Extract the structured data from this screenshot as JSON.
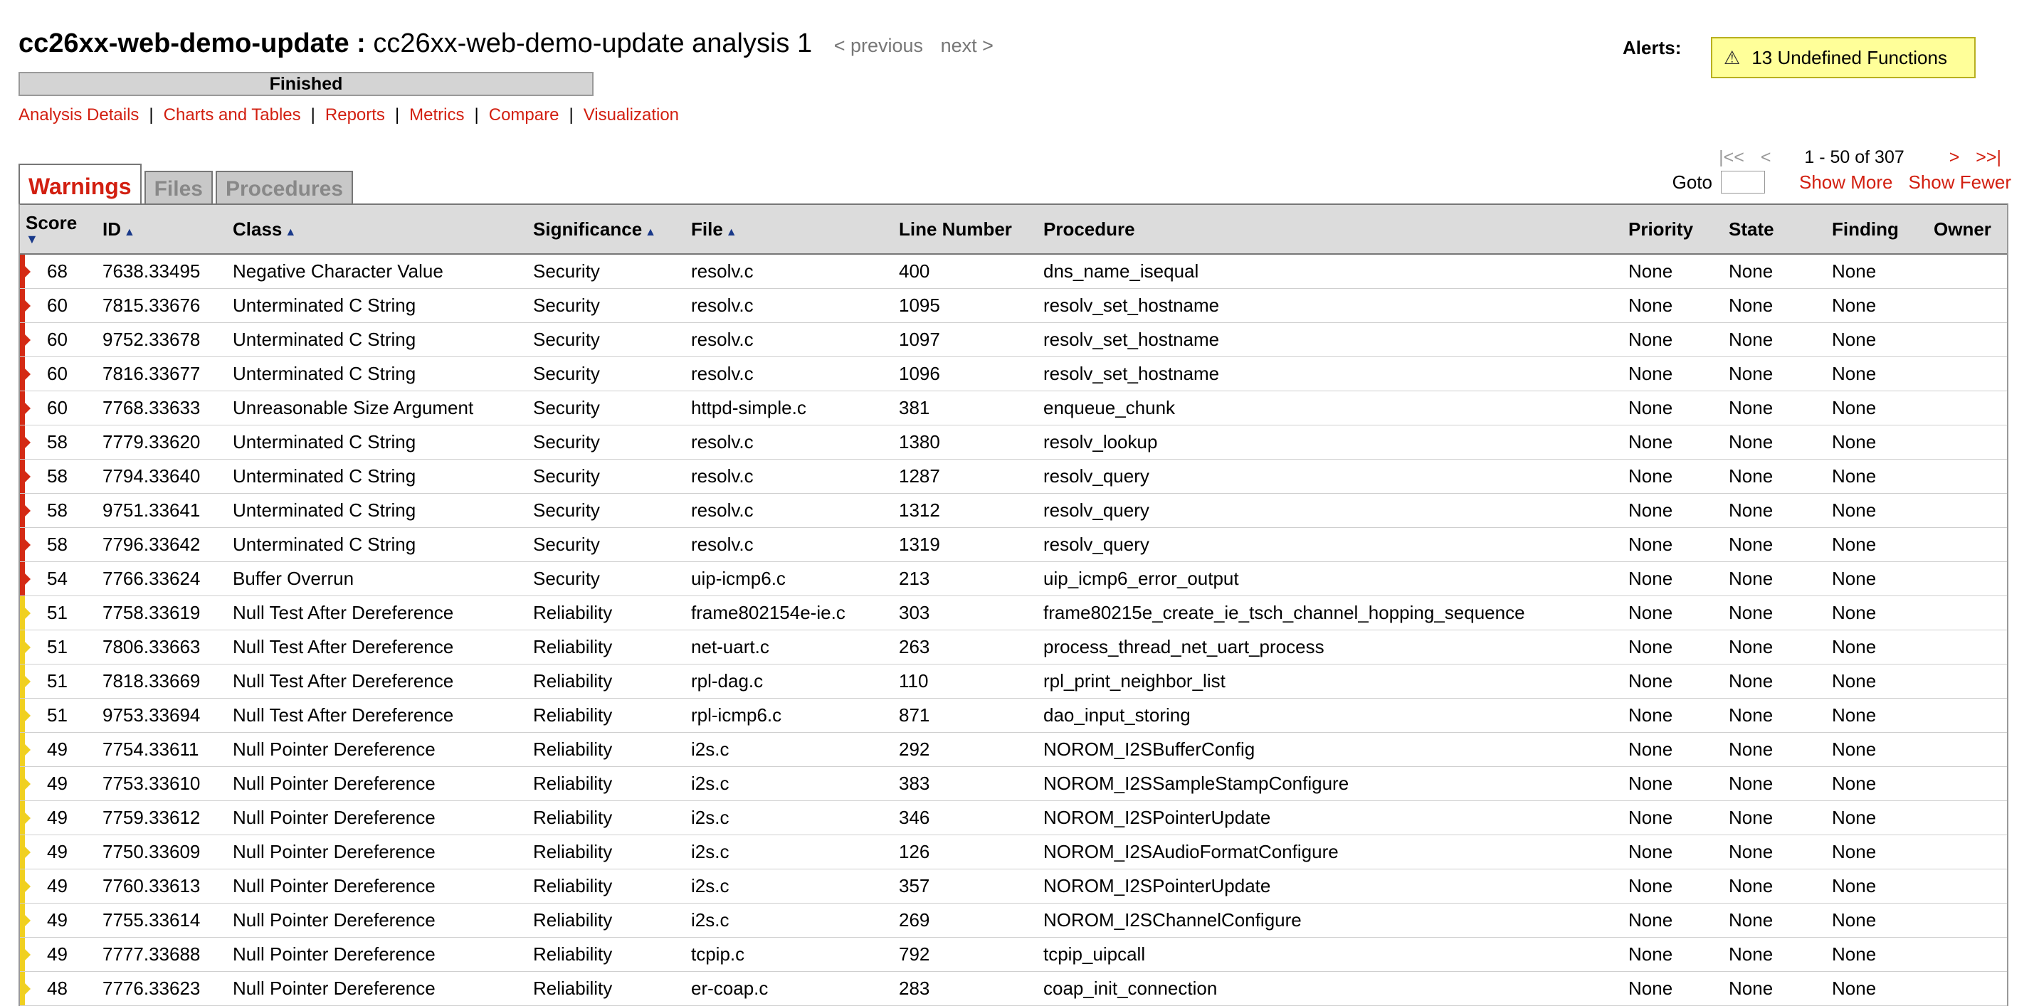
{
  "header": {
    "project": "cc26xx-web-demo-update :",
    "analysis": "cc26xx-web-demo-update analysis 1",
    "prev_label": "< previous",
    "next_label": "next >",
    "status": "Finished",
    "progress_fraction": 1.0
  },
  "nav": {
    "items": [
      {
        "label": "Analysis Details"
      },
      {
        "label": "Charts and Tables"
      },
      {
        "label": "Reports"
      },
      {
        "label": "Metrics"
      },
      {
        "label": "Compare"
      },
      {
        "label": "Visualization"
      }
    ],
    "separator": "|"
  },
  "alerts": {
    "label": "Alerts:",
    "warning_glyph": "⚠",
    "text": "13 Undefined Functions",
    "icon": "warning-triangle-icon"
  },
  "pager": {
    "first": "|<<",
    "prev": "<",
    "range": "1 - 50 of 307",
    "next": ">",
    "last": ">>|",
    "goto_label": "Goto",
    "goto_value": "",
    "show_more": "Show More",
    "show_fewer": "Show Fewer"
  },
  "tabs": [
    {
      "label": "Warnings",
      "active": true
    },
    {
      "label": "Files",
      "active": false
    },
    {
      "label": "Procedures",
      "active": false
    }
  ],
  "colors": {
    "accent": "#d21f10",
    "flag_security": "#d42a14",
    "flag_reliability": "#f0d020"
  },
  "table": {
    "columns": [
      {
        "label": "Score",
        "sort": "▼"
      },
      {
        "label": "ID",
        "sort": "▲"
      },
      {
        "label": "Class",
        "sort": "▲"
      },
      {
        "label": "Significance",
        "sort": "▲"
      },
      {
        "label": "File",
        "sort": "▲"
      },
      {
        "label": "Line Number",
        "sort": ""
      },
      {
        "label": "Procedure",
        "sort": ""
      },
      {
        "label": "Priority",
        "sort": ""
      },
      {
        "label": "State",
        "sort": ""
      },
      {
        "label": "Finding",
        "sort": ""
      },
      {
        "label": "Owner",
        "sort": ""
      }
    ],
    "rows": [
      [
        "68",
        "7638.33495",
        "Negative Character Value",
        "Security",
        "resolv.c",
        "400",
        "dns_name_isequal",
        "None",
        "None",
        "None",
        ""
      ],
      [
        "60",
        "7815.33676",
        "Unterminated C String",
        "Security",
        "resolv.c",
        "1095",
        "resolv_set_hostname",
        "None",
        "None",
        "None",
        ""
      ],
      [
        "60",
        "9752.33678",
        "Unterminated C String",
        "Security",
        "resolv.c",
        "1097",
        "resolv_set_hostname",
        "None",
        "None",
        "None",
        ""
      ],
      [
        "60",
        "7816.33677",
        "Unterminated C String",
        "Security",
        "resolv.c",
        "1096",
        "resolv_set_hostname",
        "None",
        "None",
        "None",
        ""
      ],
      [
        "60",
        "7768.33633",
        "Unreasonable Size Argument",
        "Security",
        "httpd-simple.c",
        "381",
        "enqueue_chunk",
        "None",
        "None",
        "None",
        ""
      ],
      [
        "58",
        "7779.33620",
        "Unterminated C String",
        "Security",
        "resolv.c",
        "1380",
        "resolv_lookup",
        "None",
        "None",
        "None",
        ""
      ],
      [
        "58",
        "7794.33640",
        "Unterminated C String",
        "Security",
        "resolv.c",
        "1287",
        "resolv_query",
        "None",
        "None",
        "None",
        ""
      ],
      [
        "58",
        "9751.33641",
        "Unterminated C String",
        "Security",
        "resolv.c",
        "1312",
        "resolv_query",
        "None",
        "None",
        "None",
        ""
      ],
      [
        "58",
        "7796.33642",
        "Unterminated C String",
        "Security",
        "resolv.c",
        "1319",
        "resolv_query",
        "None",
        "None",
        "None",
        ""
      ],
      [
        "54",
        "7766.33624",
        "Buffer Overrun",
        "Security",
        "uip-icmp6.c",
        "213",
        "uip_icmp6_error_output",
        "None",
        "None",
        "None",
        ""
      ],
      [
        "51",
        "7758.33619",
        "Null Test After Dereference",
        "Reliability",
        "frame802154e-ie.c",
        "303",
        "frame80215e_create_ie_tsch_channel_hopping_sequence",
        "None",
        "None",
        "None",
        ""
      ],
      [
        "51",
        "7806.33663",
        "Null Test After Dereference",
        "Reliability",
        "net-uart.c",
        "263",
        "process_thread_net_uart_process",
        "None",
        "None",
        "None",
        ""
      ],
      [
        "51",
        "7818.33669",
        "Null Test After Dereference",
        "Reliability",
        "rpl-dag.c",
        "110",
        "rpl_print_neighbor_list",
        "None",
        "None",
        "None",
        ""
      ],
      [
        "51",
        "9753.33694",
        "Null Test After Dereference",
        "Reliability",
        "rpl-icmp6.c",
        "871",
        "dao_input_storing",
        "None",
        "None",
        "None",
        ""
      ],
      [
        "49",
        "7754.33611",
        "Null Pointer Dereference",
        "Reliability",
        "i2s.c",
        "292",
        "NOROM_I2SBufferConfig",
        "None",
        "None",
        "None",
        ""
      ],
      [
        "49",
        "7753.33610",
        "Null Pointer Dereference",
        "Reliability",
        "i2s.c",
        "383",
        "NOROM_I2SSampleStampConfigure",
        "None",
        "None",
        "None",
        ""
      ],
      [
        "49",
        "7759.33612",
        "Null Pointer Dereference",
        "Reliability",
        "i2s.c",
        "346",
        "NOROM_I2SPointerUpdate",
        "None",
        "None",
        "None",
        ""
      ],
      [
        "49",
        "7750.33609",
        "Null Pointer Dereference",
        "Reliability",
        "i2s.c",
        "126",
        "NOROM_I2SAudioFormatConfigure",
        "None",
        "None",
        "None",
        ""
      ],
      [
        "49",
        "7760.33613",
        "Null Pointer Dereference",
        "Reliability",
        "i2s.c",
        "357",
        "NOROM_I2SPointerUpdate",
        "None",
        "None",
        "None",
        ""
      ],
      [
        "49",
        "7755.33614",
        "Null Pointer Dereference",
        "Reliability",
        "i2s.c",
        "269",
        "NOROM_I2SChannelConfigure",
        "None",
        "None",
        "None",
        ""
      ],
      [
        "49",
        "7777.33688",
        "Null Pointer Dereference",
        "Reliability",
        "tcpip.c",
        "792",
        "tcpip_uipcall",
        "None",
        "None",
        "None",
        ""
      ],
      [
        "48",
        "7776.33623",
        "Null Pointer Dereference",
        "Reliability",
        "er-coap.c",
        "283",
        "coap_init_connection",
        "None",
        "None",
        "None",
        ""
      ]
    ]
  }
}
